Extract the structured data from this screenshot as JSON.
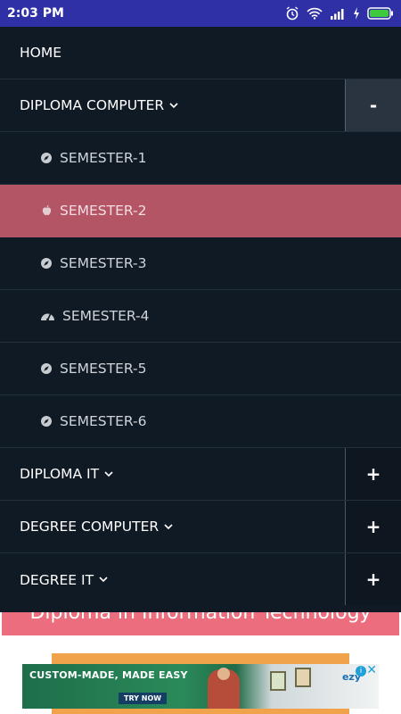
{
  "status_bar": {
    "time": "2:03 PM"
  },
  "nav": {
    "items": [
      {
        "label": "HOME"
      },
      {
        "label": "DIPLOMA COMPUTER",
        "toggle": "-"
      },
      {
        "label": "DIPLOMA IT",
        "toggle": "+"
      },
      {
        "label": "DEGREE COMPUTER",
        "toggle": "+"
      },
      {
        "label": "DEGREE IT",
        "toggle": "+"
      }
    ],
    "subitems": [
      {
        "label": "SEMESTER-1",
        "icon": "compass-icon"
      },
      {
        "label": "SEMESTER-2",
        "icon": "apple-icon",
        "active": true
      },
      {
        "label": "SEMESTER-3",
        "icon": "compass-icon"
      },
      {
        "label": "SEMESTER-4",
        "icon": "dashboard-icon"
      },
      {
        "label": "SEMESTER-5",
        "icon": "compass-icon"
      },
      {
        "label": "SEMESTER-6",
        "icon": "compass-icon"
      }
    ]
  },
  "content": {
    "heading": "Diploma in Information Technology"
  },
  "ad": {
    "headline": "CUSTOM-MADE, MADE EASY",
    "cta": "TRY NOW",
    "brand": "ezy"
  },
  "colors": {
    "nav_bg": "#101a25",
    "active_bg": "#b35565",
    "status_bar": "#2f2fa6",
    "heading_bar": "#ec6e7e"
  }
}
